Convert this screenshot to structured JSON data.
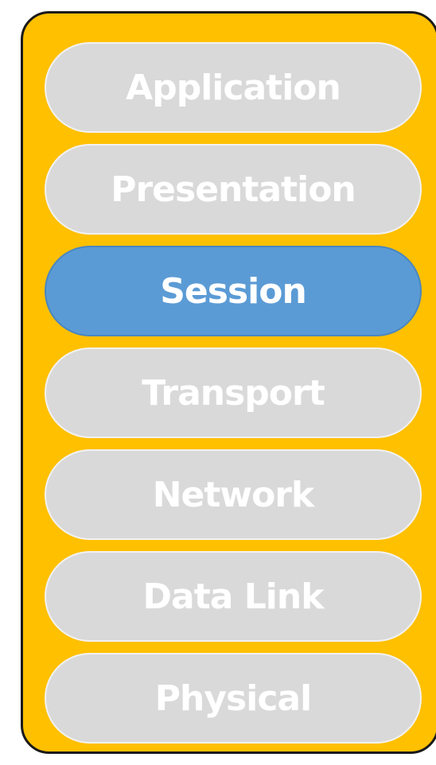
{
  "diagram": {
    "colors": {
      "container": "#FFC000",
      "border": "#1A1A1A",
      "layer": "#D9D9D9",
      "layer_active": "#5B9BD5",
      "text": "#FFFFFF"
    },
    "highlighted_layer": "Session",
    "layers": [
      {
        "label": "Application"
      },
      {
        "label": "Presentation"
      },
      {
        "label": "Session"
      },
      {
        "label": "Transport"
      },
      {
        "label": "Network"
      },
      {
        "label": "Data Link"
      },
      {
        "label": "Physical"
      }
    ]
  }
}
